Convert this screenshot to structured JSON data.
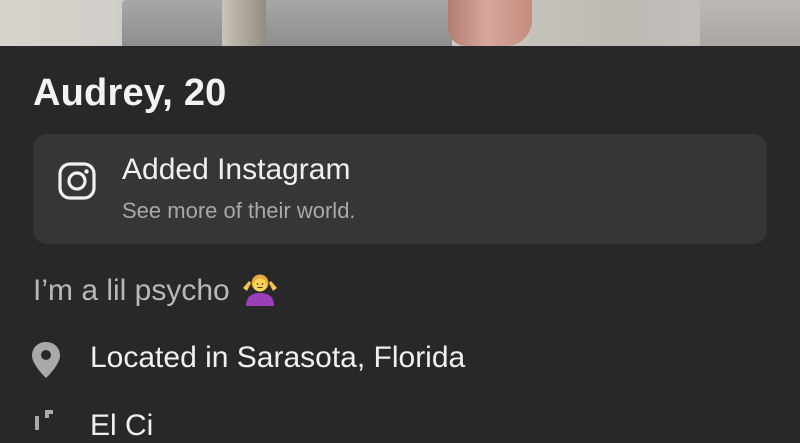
{
  "profile": {
    "name_age": "Audrey, 20",
    "photo_icon": "profile-photo"
  },
  "instagram": {
    "icon": "instagram-icon",
    "title": "Added Instagram",
    "subtitle": "See more of their world."
  },
  "bio": {
    "text": "I’m a lil psycho",
    "emoji": "person-shrugging-emoji"
  },
  "details": [
    {
      "icon": "location-pin-icon",
      "text": "Located in Sarasota, Florida"
    },
    {
      "icon": "school-icon",
      "text": "El Ci"
    }
  ],
  "colors": {
    "background": "#28282a",
    "card": "#363638",
    "text_primary": "#f0f0f0",
    "text_secondary": "#a8a8aa"
  }
}
